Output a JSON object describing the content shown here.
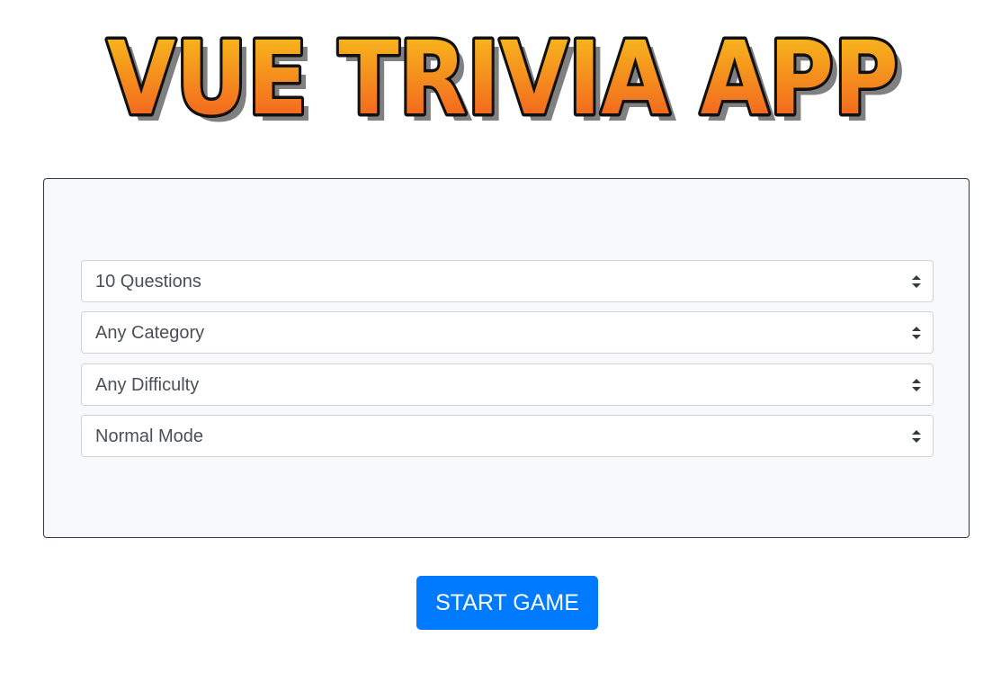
{
  "app": {
    "logo_text": "VUE TRIVIA APP"
  },
  "settings": {
    "questions": {
      "selected": "10 Questions"
    },
    "category": {
      "selected": "Any Category"
    },
    "difficulty": {
      "selected": "Any Difficulty"
    },
    "mode": {
      "selected": "Normal Mode"
    }
  },
  "actions": {
    "start_label": "START GAME"
  },
  "colors": {
    "accent": "#007bff",
    "card_bg": "#f8f9fa",
    "logo_top": "#f7c41c",
    "logo_bottom": "#f2541f"
  },
  "icons": {
    "select_caret": "caret-up-down-icon"
  }
}
